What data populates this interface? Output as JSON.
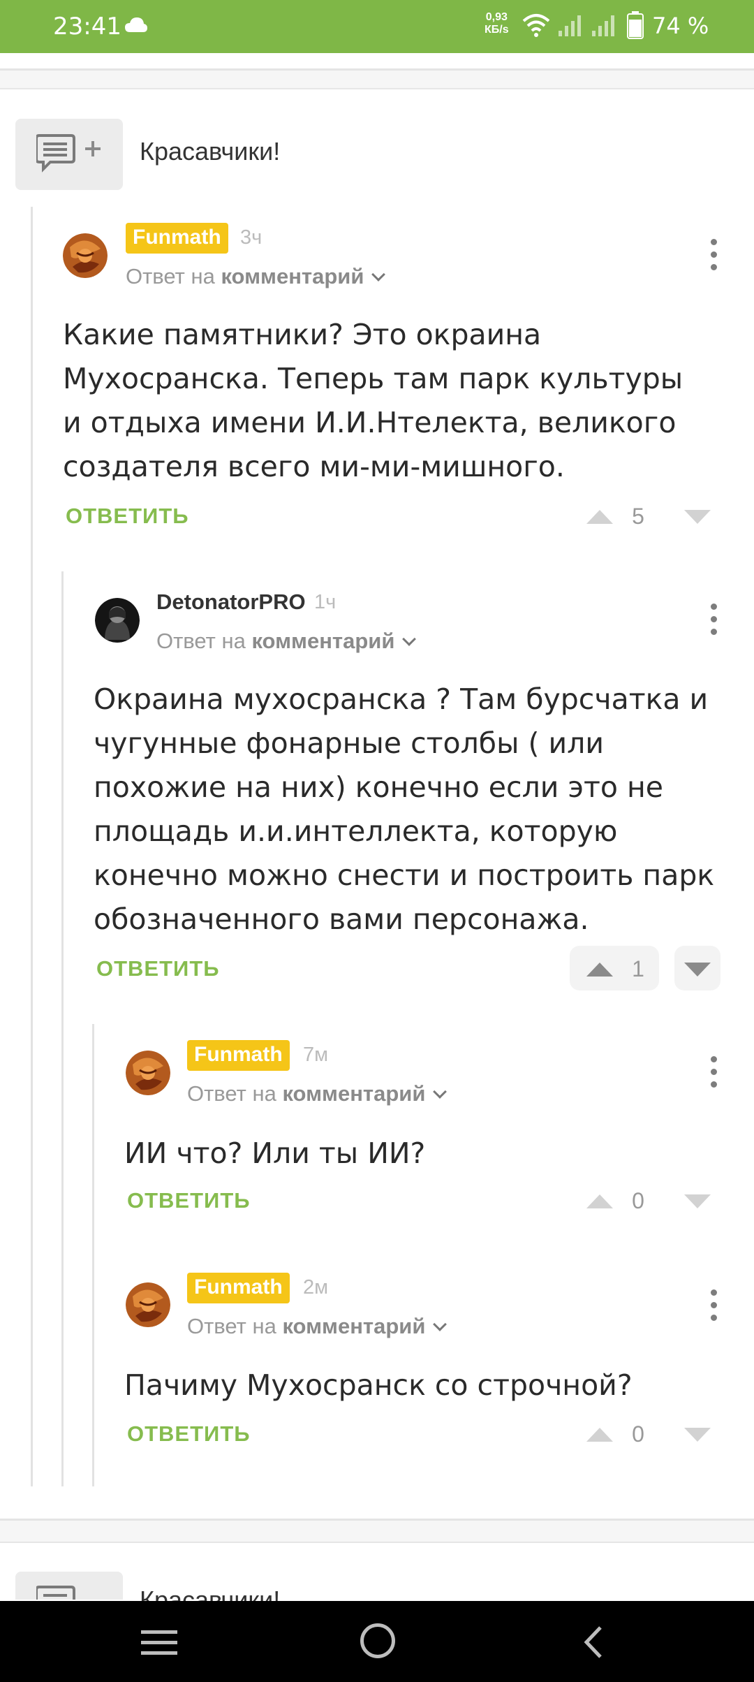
{
  "status_bar": {
    "time": "23:41",
    "net_speed_value": "0,93",
    "net_speed_unit": "КБ/s",
    "battery": "74 %"
  },
  "post": {
    "title": "Красавчики!",
    "icon": "comment-add-icon"
  },
  "next_post": {
    "title": "Красавчики!"
  },
  "reply_label": "ОТВЕТИТЬ",
  "reply_to": {
    "prefix": "Ответ на",
    "target": "комментарий"
  },
  "comments": [
    {
      "user": "Funmath",
      "time": "3ч",
      "text": "Какие памятники? Это окраина Мухосранска. Теперь там парк культуры и отдыха имени И.И.Нтелекта, великого создателя всего ми-ми-мишного.",
      "votes": "5"
    },
    {
      "user": "DetonatorPRO",
      "time": "1ч",
      "text": "Окраина мухосранска ? Там бурсчатка и чугунные фонарные столбы ( или похожие на них) конечно если это не площадь и.и.интеллекта, которую конечно можно снести и построить парк обозначенного вами персонажа.",
      "votes": "1"
    },
    {
      "user": "Funmath",
      "time": "7м",
      "text": "ИИ что? Или ты ИИ?",
      "votes": "0"
    },
    {
      "user": "Funmath",
      "time": "2м",
      "text": "Пачиму Мухосранск со строчной?",
      "votes": "0"
    }
  ],
  "colors": {
    "status_bar": "#7fb747",
    "reply_green": "#86bc4e",
    "badge_yellow": "#f5c518"
  }
}
